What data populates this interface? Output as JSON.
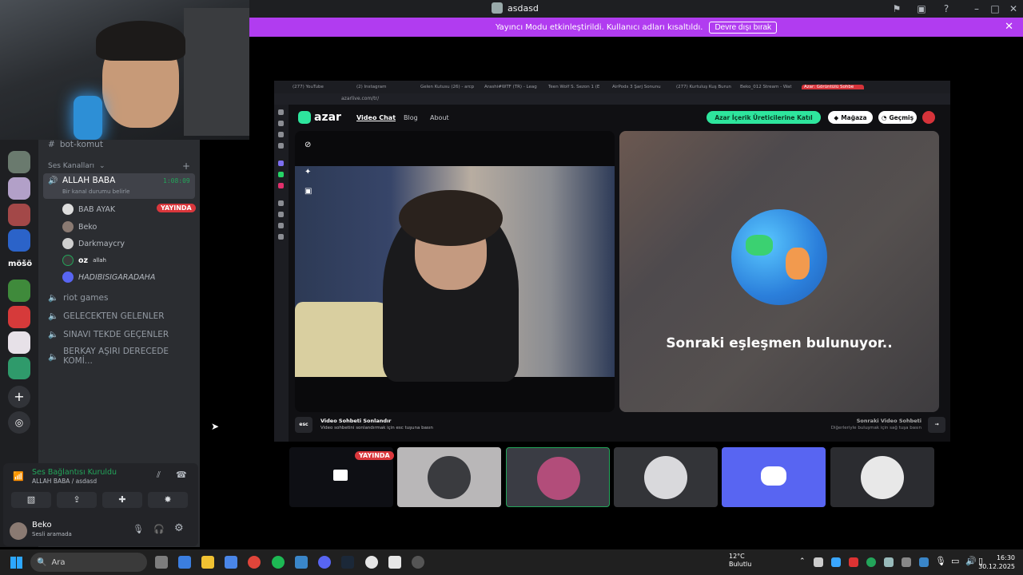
{
  "window": {
    "title": "asdasd"
  },
  "banner": {
    "message": "Yayıncı Modu etkinleştirildi. Kullanıcı adları kısaltıldı.",
    "button": "Devre dışı bırak"
  },
  "channels": {
    "text_channel": "bot-komut",
    "voice_header": "Ses Kanalları",
    "active_channel": {
      "name": "ALLAH BABA",
      "timer": "1:08:09",
      "status": "Bir kanal durumu belirle"
    },
    "users": [
      {
        "name": "BAB AYAK",
        "badge": "YAYINDA"
      },
      {
        "name": "Beko"
      },
      {
        "name": "Darkmaycry"
      },
      {
        "name": "oz",
        "extra": "allah"
      },
      {
        "name": "HADIBISIGARADAHA"
      }
    ],
    "other_channels": [
      "riot games",
      "GELECEKTEN GELENLER",
      "SINAVI TEKDE GEÇENLER",
      "BERKAY AŞIRI DERECEDE KOMİ..."
    ]
  },
  "rail": {
    "label": "möšö"
  },
  "voice_panel": {
    "status": "Ses Bağlantısı Kuruldu",
    "location": "ALLAH BABA / asdasd",
    "user": "Beko",
    "user_status": "Sesli aramada"
  },
  "browser": {
    "tabs": [
      "(277) YouTube",
      "(2) Instagram",
      "Gelen Kutusu (26) - arcp",
      "Arashi#WTF (TR) - Leag",
      "Teen Wolf S. Sezon 1 (E",
      "AirPods 3 Şarj Sonunu",
      "(277) Kurtuluş Kuş Burun",
      "Beko_012 Stream - Wat",
      "Azar: Görüntülü Sohbe"
    ],
    "url": "azarlive.com/tr/"
  },
  "azar": {
    "logo": "azar",
    "nav": [
      "Video Chat",
      "Blog",
      "About"
    ],
    "creator_button": "Azar İçerik Üreticilerine Katıl",
    "store_button": "Mağaza",
    "history_button": "Geçmiş",
    "searching": "Sonraki eşleşmen bulunuyor..",
    "end_title": "Video Sohbeti Sonlandır",
    "end_hint": "Video sohbetini sonlandırmak için esc tuşuna basın",
    "esc_key": "esc",
    "next_title": "Sonraki Video Sohbeti",
    "next_hint": "Diğerleriyle buluşmak için sağ tuşa basın"
  },
  "stream_tiles": {
    "live_badge": "YAYINDA"
  },
  "taskbar": {
    "search": "Ara",
    "weather_temp": "12°C",
    "weather_desc": "Bulutlu",
    "time": "16:30",
    "date": "30.12.2025"
  },
  "colors": {
    "accent": "#b13cf0",
    "discord_blurple": "#5865f2",
    "azar_green": "#2ee59d",
    "live_red": "#da373c"
  }
}
